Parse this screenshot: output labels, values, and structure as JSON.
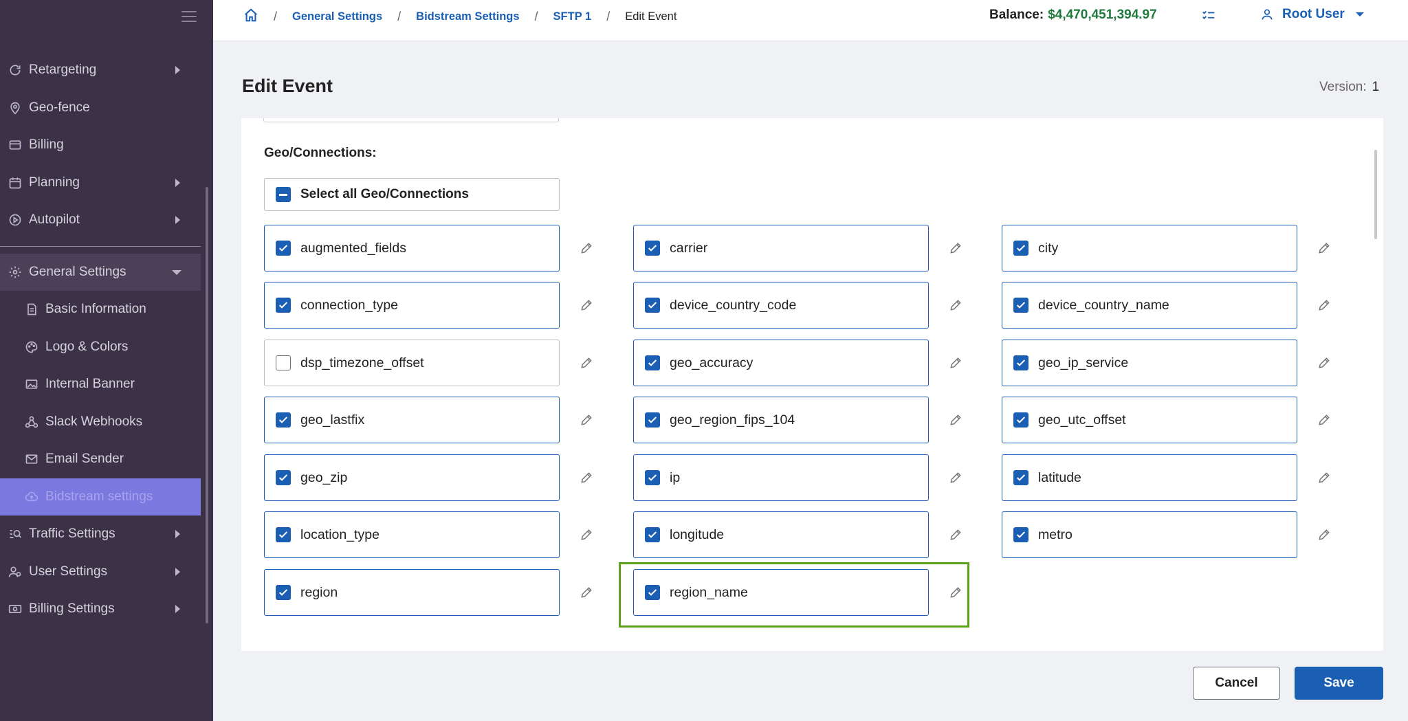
{
  "sidebar": {
    "items": [
      {
        "label": "Retargeting",
        "icon": "refresh-icon",
        "has_arrow": true
      },
      {
        "label": "Geo-fence",
        "icon": "map-pin-icon",
        "has_arrow": false
      },
      {
        "label": "Billing",
        "icon": "credit-card-icon",
        "has_arrow": false
      },
      {
        "label": "Planning",
        "icon": "calendar-icon",
        "has_arrow": true
      },
      {
        "label": "Autopilot",
        "icon": "play-circle-icon",
        "has_arrow": true
      }
    ],
    "general_settings": {
      "label": "General Settings",
      "icon": "gear-icon",
      "subitems": [
        {
          "label": "Basic Information",
          "icon": "document-icon"
        },
        {
          "label": "Logo & Colors",
          "icon": "palette-icon"
        },
        {
          "label": "Internal Banner",
          "icon": "image-icon"
        },
        {
          "label": "Slack Webhooks",
          "icon": "webhook-icon"
        },
        {
          "label": "Email Sender",
          "icon": "envelope-icon"
        },
        {
          "label": "Bidstream settings",
          "icon": "cloud-upload-icon",
          "active": true
        }
      ]
    },
    "bottom_items": [
      {
        "label": "Traffic Settings",
        "icon": "traffic-icon",
        "has_arrow": true
      },
      {
        "label": "User Settings",
        "icon": "users-icon",
        "has_arrow": true
      },
      {
        "label": "Billing Settings",
        "icon": "money-icon",
        "has_arrow": true
      }
    ]
  },
  "topbar": {
    "breadcrumbs": [
      "General Settings",
      "Bidstream Settings",
      "SFTP 1"
    ],
    "current": "Edit Event",
    "balance_label": "Balance:",
    "balance_value": "$4,470,451,394.97",
    "user_name": "Root User"
  },
  "page": {
    "title": "Edit Event",
    "version_label": "Version:",
    "version_value": "1"
  },
  "section": {
    "label": "Geo/Connections:",
    "select_all_label": "Select all Geo/Connections",
    "fields": [
      {
        "name": "augmented_fields",
        "checked": true
      },
      {
        "name": "carrier",
        "checked": true
      },
      {
        "name": "city",
        "checked": true
      },
      {
        "name": "connection_type",
        "checked": true
      },
      {
        "name": "device_country_code",
        "checked": true
      },
      {
        "name": "device_country_name",
        "checked": true
      },
      {
        "name": "dsp_timezone_offset",
        "checked": false
      },
      {
        "name": "geo_accuracy",
        "checked": true
      },
      {
        "name": "geo_ip_service",
        "checked": true
      },
      {
        "name": "geo_lastfix",
        "checked": true
      },
      {
        "name": "geo_region_fips_104",
        "checked": true
      },
      {
        "name": "geo_utc_offset",
        "checked": true
      },
      {
        "name": "geo_zip",
        "checked": true
      },
      {
        "name": "ip",
        "checked": true
      },
      {
        "name": "latitude",
        "checked": true
      },
      {
        "name": "location_type",
        "checked": true
      },
      {
        "name": "longitude",
        "checked": true
      },
      {
        "name": "metro",
        "checked": true
      },
      {
        "name": "region",
        "checked": true
      },
      {
        "name": "region_name",
        "checked": true
      }
    ]
  },
  "buttons": {
    "cancel": "Cancel",
    "save": "Save"
  },
  "colors": {
    "sidebar_bg": "#3b3247",
    "accent": "#1a5fb4",
    "active_nav": "#7b78e0",
    "balance": "#1f7a3d",
    "highlight": "#5ea11e"
  }
}
